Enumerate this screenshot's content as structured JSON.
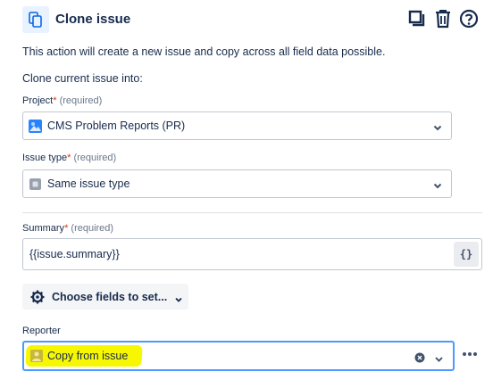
{
  "header": {
    "title": "Clone issue",
    "icons": [
      "clone-icon",
      "copy-icon",
      "trash-icon",
      "help-icon"
    ]
  },
  "description": "This action will create a new issue and copy across all field data possible.",
  "clone_into_label": "Clone current issue into:",
  "project": {
    "label": "Project",
    "required_mark": "*",
    "required_text": " (required)",
    "value": "CMS Problem Reports (PR)",
    "icon": "project-avatar-icon"
  },
  "issue_type": {
    "label": "Issue type",
    "required_mark": "*",
    "required_text": " (required)",
    "value": "Same issue type",
    "icon": "issue-type-icon"
  },
  "summary": {
    "label": "Summary",
    "required_mark": "*",
    "required_text": " (required)",
    "value": "{{issue.summary}}",
    "smart_value_button": "{}"
  },
  "choose_fields": {
    "label": "Choose fields to set..."
  },
  "reporter": {
    "label": "Reporter",
    "value": "Copy from issue"
  },
  "colors": {
    "accent": "#4c9aff",
    "highlight": "#f7f702",
    "required": "#de350b"
  }
}
